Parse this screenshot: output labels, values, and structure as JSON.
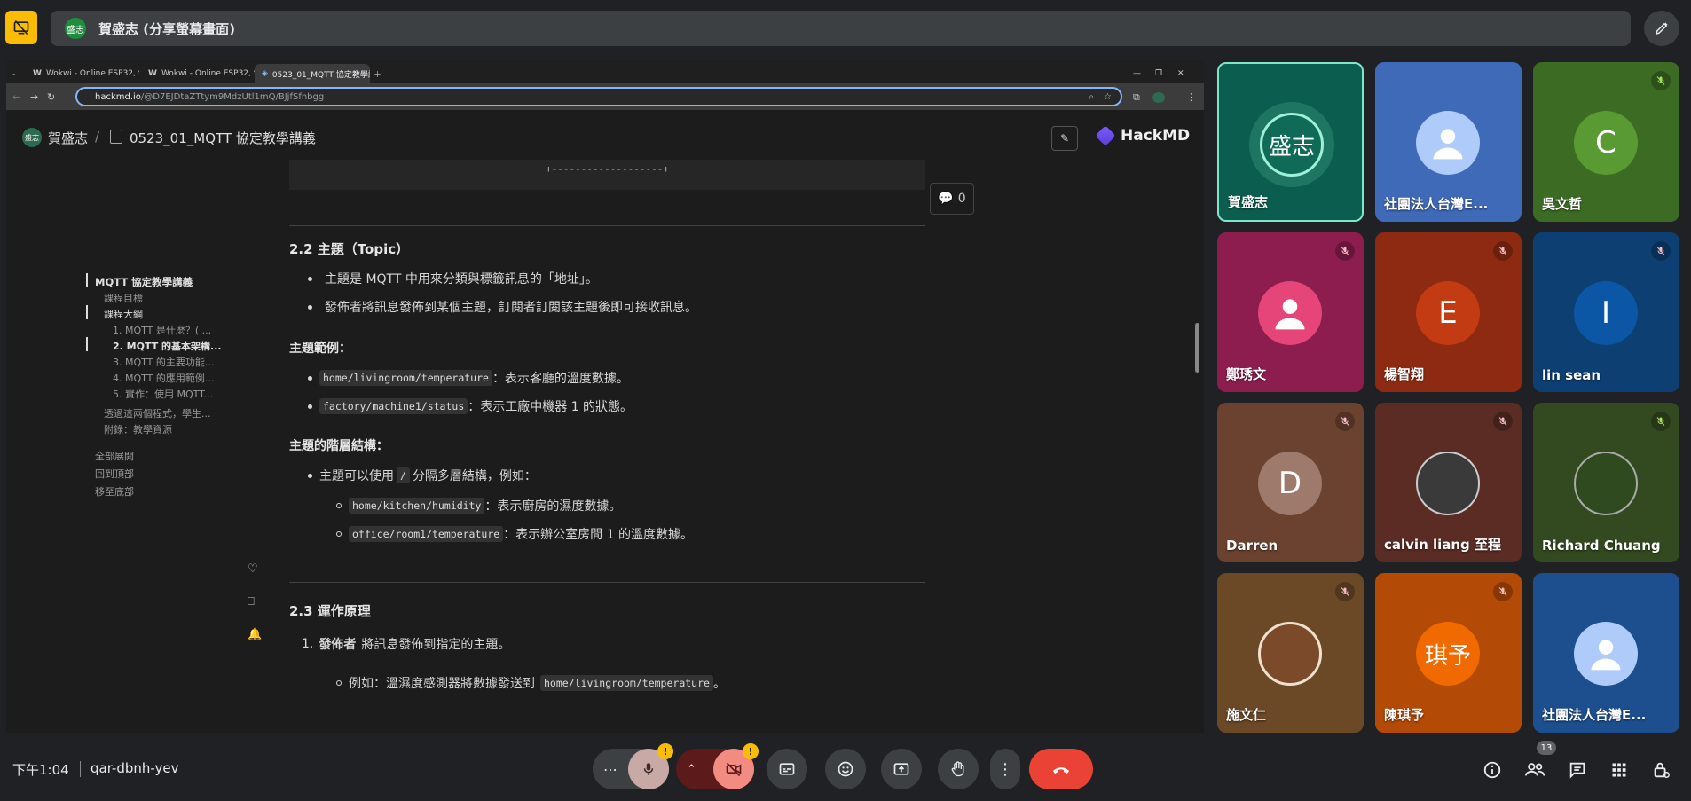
{
  "present": {
    "avatar_text": "盛志",
    "title": "賀盛志 (分享螢幕畫面)"
  },
  "browser": {
    "tabs": [
      {
        "label": "Wokwi - Online ESP32, STM3..."
      },
      {
        "label": "Wokwi - Online ESP32, STM3..."
      },
      {
        "label": "0523_01_MQTT 協定教學講義"
      }
    ],
    "url_host": "hackmd.io",
    "url_path": "/@D7EJDtaZTtym9MdzUtl1mQ/BJjfSfnbgg"
  },
  "hackmd": {
    "user_avatar": "盛志",
    "user": "賀盛志",
    "separator": "/",
    "doc_title": "0523_01_MQTT 協定教學講義",
    "logo": "HackMD",
    "code_remnant": "+-------------------+",
    "comment_count": "0",
    "toc": {
      "title": "MQTT 協定教學講義",
      "items": [
        "課程目標",
        "課程大綱",
        "1. MQTT 是什麼？( ...",
        "2. MQTT 的基本架構...",
        "3. MQTT 的主要功能...",
        "4. MQTT 的應用範例...",
        "5. 實作：使用 MQTT...",
        "透過這兩個程式，學生...",
        "附錄：教學資源"
      ],
      "expand_all": "全部展開",
      "back_to_top": "回到頂部",
      "to_bottom": "移至底部"
    },
    "content": {
      "h_topic": "2.2 主題（Topic）",
      "topic_li1": "主題是 MQTT 中用來分類與標籤訊息的「地址」。",
      "topic_li2": "發佈者將訊息發佈到某個主題，訂閱者訂閱該主題後即可接收訊息。",
      "h_examples": "主題範例：",
      "ex1_code": "home/livingroom/temperature",
      "ex1_text": "：表示客廳的溫度數據。",
      "ex2_code": "factory/machine1/status",
      "ex2_text": "：表示工廠中機器 1 的狀態。",
      "h_hierarchy": "主題的階層結構：",
      "hier_pre": "主題可以使用",
      "hier_code": "/",
      "hier_post": "分隔多層結構，例如：",
      "sub1_code": "home/kitchen/humidity",
      "sub1_text": "：表示廚房的濕度數據。",
      "sub2_code": "office/room1/temperature",
      "sub2_text": "：表示辦公室房間 1 的溫度數據。",
      "h_principle": "2.3 運作原理",
      "p1_num": "1.",
      "p1_bold": "發佈者",
      "p1_text": "將訊息發佈到指定的主題。",
      "p1_sub_pre": "例如：溫濕度感測器將數據發送到",
      "p1_sub_code": "home/livingroom/temperature",
      "p1_sub_post": "。"
    }
  },
  "participants": [
    {
      "name": "賀盛志",
      "avatar": "盛志",
      "color": "#0b5e4f"
    },
    {
      "name": "社團法人台灣E...",
      "avatar": "",
      "color": "#3f6ab8"
    },
    {
      "name": "吳文哲",
      "avatar": "C",
      "color": "#3c6b24"
    },
    {
      "name": "鄭琇文",
      "avatar": "",
      "color": "#8c1d4e"
    },
    {
      "name": "楊智翔",
      "avatar": "E",
      "color": "#8f2a12"
    },
    {
      "name": "lin sean",
      "avatar": "I",
      "color": "#0d3f73"
    },
    {
      "name": "Darren",
      "avatar": "D",
      "color": "#6b4230"
    },
    {
      "name": "calvin liang 至程",
      "avatar": "",
      "color": "#5a2c24"
    },
    {
      "name": "Richard Chuang",
      "avatar": "",
      "color": "#33491f"
    },
    {
      "name": "施文仁",
      "avatar": "",
      "color": "#6b4826"
    },
    {
      "name": "陳琪予",
      "avatar": "琪予",
      "color": "#b34a06"
    },
    {
      "name": "社團法人台灣E...",
      "avatar": "",
      "color": "#1d4f8f"
    }
  ],
  "bottom": {
    "time": "下午1:04",
    "meeting_code": "qar-dbnh-yev",
    "people_count": "13",
    "warn_mark": "!"
  },
  "colors": {
    "accent": "#fbbc04",
    "end_call": "#ea4335",
    "cam_off": "#f28b82"
  }
}
